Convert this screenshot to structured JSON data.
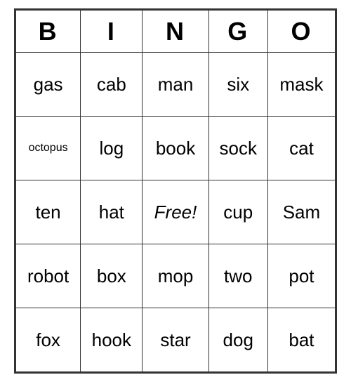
{
  "header": {
    "cols": [
      "B",
      "I",
      "N",
      "G",
      "O"
    ]
  },
  "rows": [
    [
      {
        "text": "gas",
        "size": "normal"
      },
      {
        "text": "cab",
        "size": "normal"
      },
      {
        "text": "man",
        "size": "normal"
      },
      {
        "text": "six",
        "size": "normal"
      },
      {
        "text": "mask",
        "size": "normal"
      }
    ],
    [
      {
        "text": "octopus",
        "size": "small"
      },
      {
        "text": "log",
        "size": "normal"
      },
      {
        "text": "book",
        "size": "normal"
      },
      {
        "text": "sock",
        "size": "normal"
      },
      {
        "text": "cat",
        "size": "normal"
      }
    ],
    [
      {
        "text": "ten",
        "size": "normal"
      },
      {
        "text": "hat",
        "size": "normal"
      },
      {
        "text": "Free!",
        "size": "free"
      },
      {
        "text": "cup",
        "size": "normal"
      },
      {
        "text": "Sam",
        "size": "normal"
      }
    ],
    [
      {
        "text": "robot",
        "size": "normal"
      },
      {
        "text": "box",
        "size": "normal"
      },
      {
        "text": "mop",
        "size": "normal"
      },
      {
        "text": "two",
        "size": "normal"
      },
      {
        "text": "pot",
        "size": "normal"
      }
    ],
    [
      {
        "text": "fox",
        "size": "normal"
      },
      {
        "text": "hook",
        "size": "normal"
      },
      {
        "text": "star",
        "size": "normal"
      },
      {
        "text": "dog",
        "size": "normal"
      },
      {
        "text": "bat",
        "size": "normal"
      }
    ]
  ]
}
